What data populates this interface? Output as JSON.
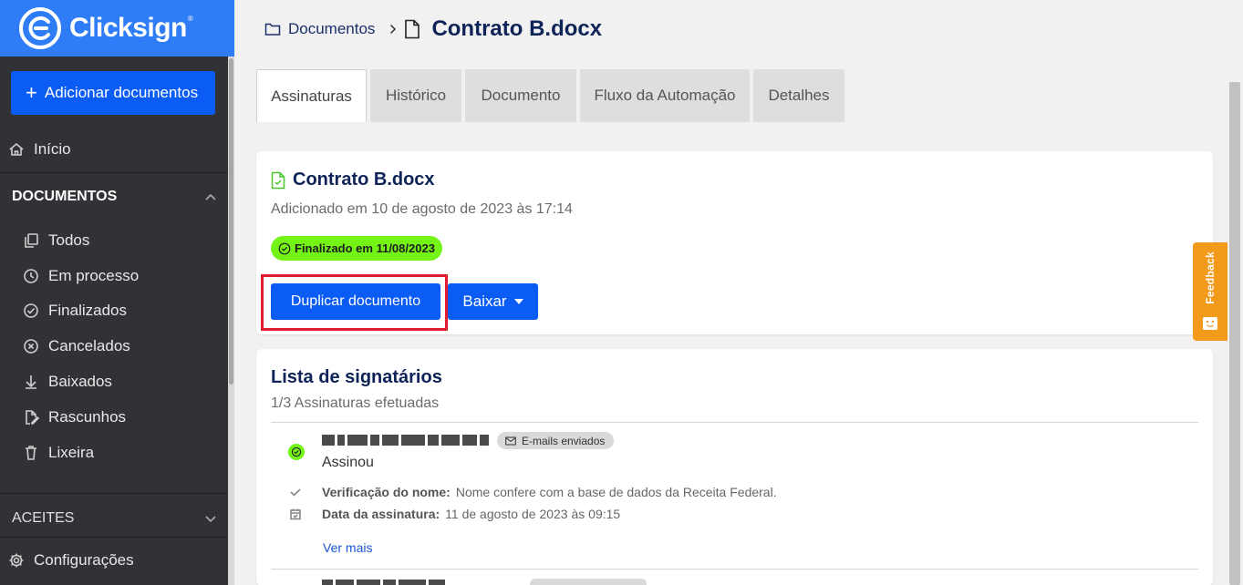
{
  "brand": {
    "name": "Clicksign",
    "reg": "®",
    "color": "#2e7cf6"
  },
  "sidebar": {
    "add_button": "Adicionar documentos",
    "home": "Início",
    "documents_section": "DOCUMENTOS",
    "items": [
      {
        "label": "Todos",
        "icon": "copy-icon"
      },
      {
        "label": "Em processo",
        "icon": "clock-icon"
      },
      {
        "label": "Finalizados",
        "icon": "check-circle-icon"
      },
      {
        "label": "Cancelados",
        "icon": "x-circle-icon"
      },
      {
        "label": "Baixados",
        "icon": "download-icon"
      },
      {
        "label": "Rascunhos",
        "icon": "draft-icon"
      },
      {
        "label": "Lixeira",
        "icon": "trash-icon"
      }
    ],
    "aceites_section": "ACEITES",
    "settings": "Configurações"
  },
  "breadcrumb": {
    "parent": "Documentos",
    "current": "Contrato B.docx"
  },
  "tabs": [
    "Assinaturas",
    "Histórico",
    "Documento",
    "Fluxo da Automação",
    "Detalhes"
  ],
  "document": {
    "title": "Contrato B.docx",
    "added": "Adicionado em 10 de agosto de 2023 às 17:14",
    "status": "Finalizado em 11/08/2023",
    "status_color": "#73f316",
    "duplicate_button": "Duplicar documento",
    "download_button": "Baixar"
  },
  "signers": {
    "title": "Lista de signatários",
    "subtitle": "1/3 Assinaturas efetuadas",
    "first": {
      "badge": "E-mails enviados",
      "status": "Assinou",
      "name_check_label": "Verificação do nome:",
      "name_check_value": "Nome confere com a base de dados da Receita Federal.",
      "date_label": "Data da assinatura:",
      "date_value": "11 de agosto de 2023 às 09:15",
      "more": "Ver mais"
    }
  },
  "feedback": {
    "label": "Feedback",
    "color": "#f39a1d"
  },
  "accent": "#0a5cf5"
}
